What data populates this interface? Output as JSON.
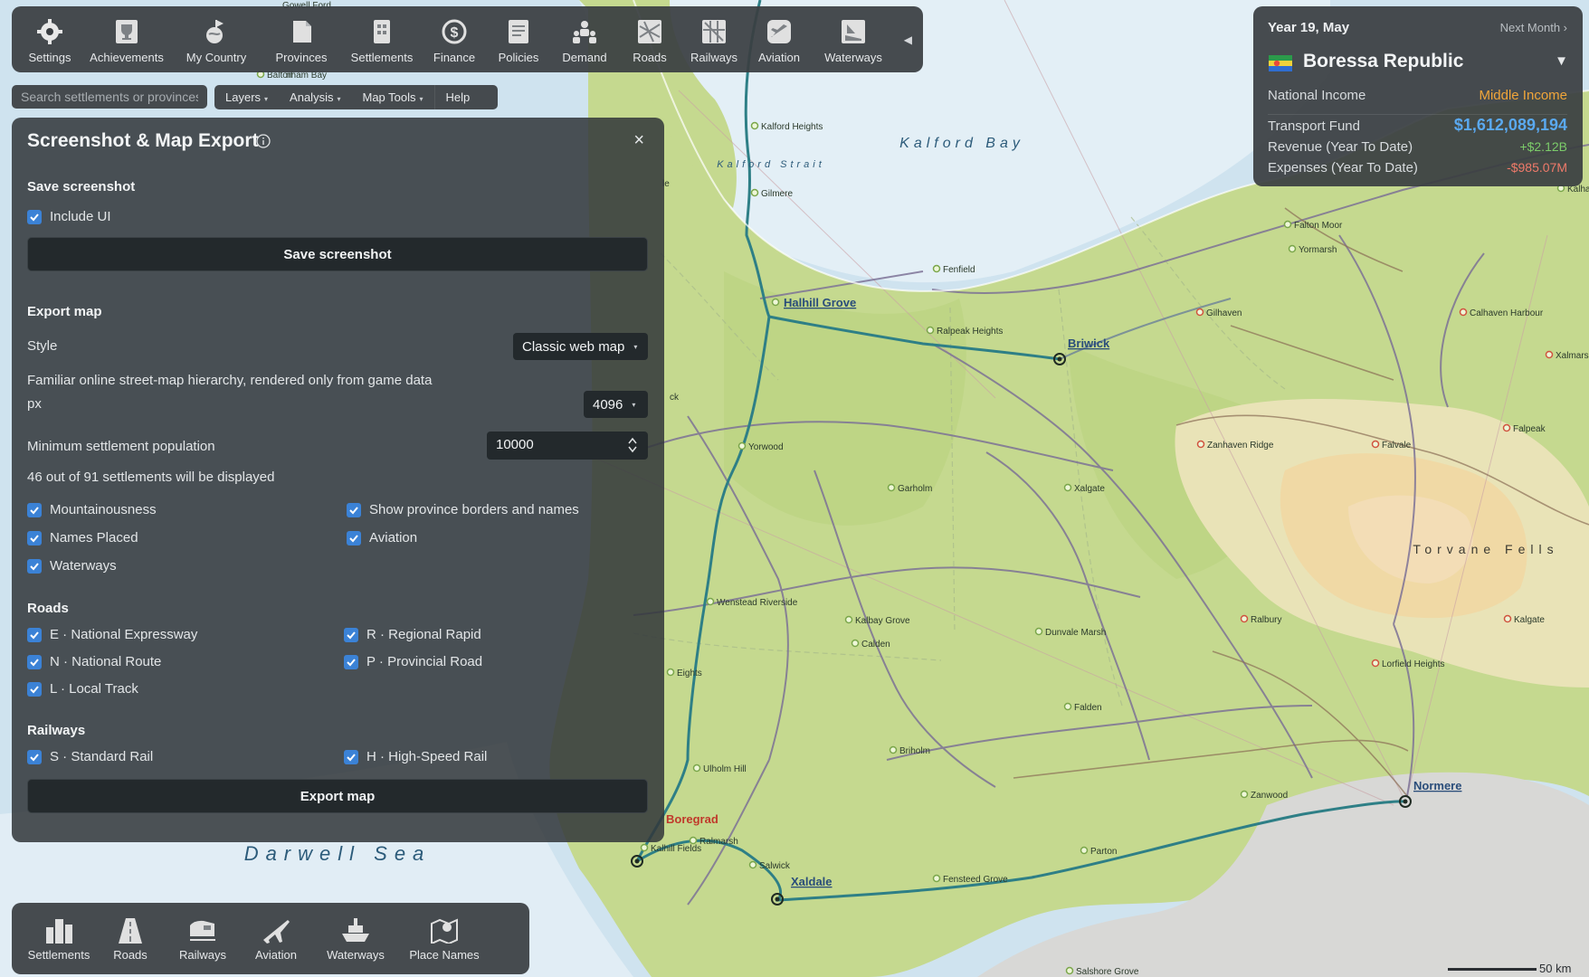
{
  "toolbar": {
    "items": [
      {
        "label": "Settings",
        "icon": "gear-icon"
      },
      {
        "label": "Achievements",
        "icon": "trophy-icon"
      },
      {
        "label": "My Country",
        "icon": "globe-icon"
      },
      {
        "label": "Provinces",
        "icon": "province-icon"
      },
      {
        "label": "Settlements",
        "icon": "building-icon"
      },
      {
        "label": "Finance",
        "icon": "coin-icon"
      },
      {
        "label": "Policies",
        "icon": "policy-icon"
      },
      {
        "label": "Demand",
        "icon": "people-icon"
      },
      {
        "label": "Roads",
        "icon": "road-map-icon"
      },
      {
        "label": "Railways",
        "icon": "railway-icon"
      },
      {
        "label": "Aviation",
        "icon": "plane-icon"
      },
      {
        "label": "Waterways",
        "icon": "ship-icon"
      }
    ],
    "collapse_arrow": "◀"
  },
  "search": {
    "placeholder": "Search settlements or provinces"
  },
  "menus": [
    {
      "label": "Layers",
      "caret": "▾"
    },
    {
      "label": "Analysis",
      "caret": "▾"
    },
    {
      "label": "Map Tools",
      "caret": "▾"
    },
    {
      "label": "Help",
      "caret": ""
    }
  ],
  "export_panel": {
    "title": "Screenshot & Map Export",
    "close": "×",
    "save_section": "Save screenshot",
    "include_ui": "Include UI",
    "save_button": "Save screenshot",
    "export_section": "Export map",
    "style_label": "Style",
    "style_value": "Classic web map",
    "style_desc": "Familiar online street-map hierarchy, rendered only from game data",
    "px_label": "px",
    "px_value": "4096",
    "min_pop_label": "Minimum settlement population",
    "min_pop_value": "10000",
    "count_text": "46 out of 91 settlements will be displayed",
    "options_left": [
      "Mountainousness",
      "Names Placed",
      "Waterways"
    ],
    "options_right": [
      "Show province borders and names",
      "Aviation"
    ],
    "roads_section": "Roads",
    "roads_left": [
      "E · National Expressway",
      "N · National Route",
      "L · Local Track"
    ],
    "roads_right": [
      "R · Regional Rapid",
      "P · Provincial Road"
    ],
    "railways_section": "Railways",
    "rail_left": [
      "S · Standard Rail"
    ],
    "rail_right": [
      "H · High-Speed Rail"
    ],
    "export_button": "Export map"
  },
  "country": {
    "date": "Year 19, May",
    "next": "Next Month ›",
    "name": "Boressa Republic",
    "dropdown": "▼",
    "income_label": "National Income",
    "income_value": "Middle Income",
    "fund_label": "Transport Fund",
    "fund_value": "$1,612,089,194",
    "revenue_label": "Revenue (Year To Date)",
    "revenue_value": "+$2.12B",
    "expenses_label": "Expenses (Year To Date)",
    "expenses_value": "-$985.07M",
    "colors": {
      "income": "#f0a53a",
      "fund": "#5aa9f0",
      "revenue": "#7ccc6a",
      "expenses": "#ef7a6a"
    }
  },
  "bottombar": {
    "items": [
      {
        "label": "Settlements",
        "icon": "city-icon"
      },
      {
        "label": "Roads",
        "icon": "road-icon"
      },
      {
        "label": "Railways",
        "icon": "train-icon"
      },
      {
        "label": "Aviation",
        "icon": "airplane-icon"
      },
      {
        "label": "Waterways",
        "icon": "boat-icon"
      },
      {
        "label": "Place Names",
        "icon": "map-pin-icon"
      }
    ]
  },
  "map": {
    "sea_labels": [
      "Kalford Bay",
      "Kalford Strait",
      "Darwell Sea"
    ],
    "region_labels": [
      "Torvane Fells"
    ],
    "major_places": [
      "Halhill Grove",
      "Briwick",
      "Normere",
      "Xaldale",
      "Boregrad"
    ],
    "places": [
      "Kalford Heights",
      "Gilmere",
      "Fenfield",
      "Ralpeak Heights",
      "Yorwood",
      "Garholm",
      "Xalgate",
      "Wenstead Riverside",
      "Kalbay Grove",
      "Calden",
      "Dunvale Marsh",
      "Falden",
      "Ulholm Hill",
      "Briholm",
      "Zanwood",
      "Parton",
      "Fensteed Grove",
      "Salwick",
      "Kalhill Fields",
      "Ralmarsh",
      "Salshore Grove",
      "Falton Moor",
      "Yormarsh",
      "Gilhaven",
      "Calhaven Harbour",
      "Xalmars",
      "Zanhaven Ridge",
      "Falvale",
      "Falpeak",
      "Ralbury",
      "Kalgate",
      "Lorfield Heights",
      "Kalha",
      "Balton",
      "Eights"
    ],
    "partial_labels": [
      "Gowell Ford",
      "nham Bay",
      "ck",
      "le"
    ],
    "scale_label": "50 km"
  }
}
